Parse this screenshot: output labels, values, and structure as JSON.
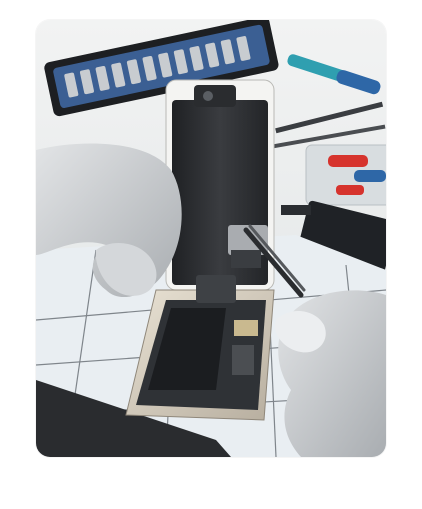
{
  "colors": {
    "page_background": "#ffffff",
    "bench": "#e6e9ea",
    "glove": "#c9cccf",
    "phone_frame": "#cfc7b9",
    "screen_back": "#2b2d30",
    "tool_blue": "#2e67a7",
    "tool_red": "#d6332d"
  },
  "icons": [
    "photo"
  ]
}
